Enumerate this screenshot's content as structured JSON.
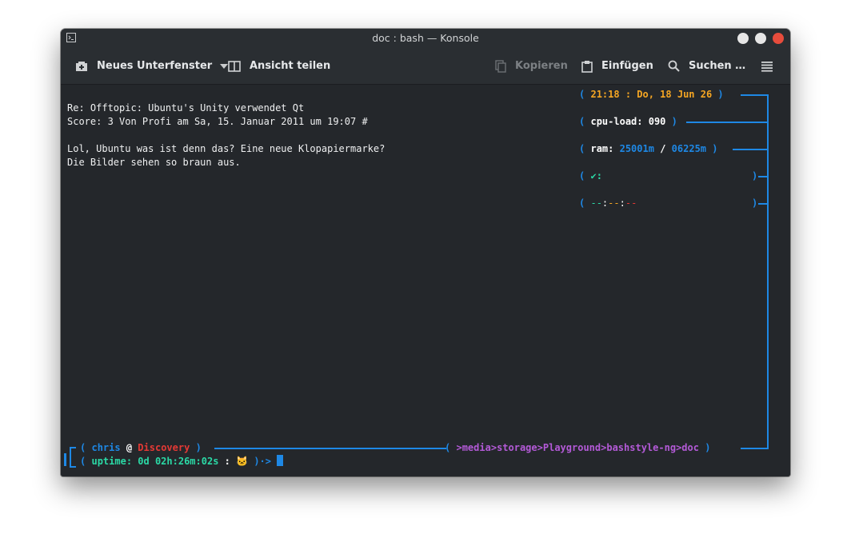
{
  "window": {
    "title": "doc : bash — Konsole",
    "icon": "terminal-icon"
  },
  "toolbar": {
    "new_tab": "Neues Unterfenster",
    "split_view": "Ansicht teilen",
    "copy": "Kopieren",
    "paste": "Einfügen",
    "find": "Suchen …"
  },
  "terminal": {
    "lines": [
      "Re: Offtopic: Ubuntu's Unity verwendet Qt",
      "Score: 3 Von Profi am Sa, 15. Januar 2011 um 19:07 #",
      "Lol, Ubuntu was ist denn das? Eine neue Klopapiermarke?",
      "Die Bilder sehen so braun aus."
    ]
  },
  "status": {
    "open_paren": "(",
    "close_paren": ")",
    "clock": "21:18 : Do, 18 Jun 26",
    "cpu_label": "cpu-load:",
    "cpu_value": "090",
    "ram_label": "ram:",
    "ram_used": "25001m",
    "ram_sep": "/",
    "ram_total": "06225m",
    "check": "✔:",
    "dash_green": "--",
    "colon1": ":",
    "dash_orange": "--",
    "colon2": ":",
    "dash_red": "--"
  },
  "prompt": {
    "user": "chris",
    "at": "@",
    "host": "Discovery",
    "path_gt": ">",
    "path_media": "media",
    "path_storage": "storage",
    "path_playground": "Playground",
    "path_bashstyle": "bashstyle-ng",
    "path_doc": "doc",
    "uptime_label": "uptime:",
    "uptime_value": "0d 02h:26m:02s",
    "uptime_sep": ":",
    "cat": "🐱",
    "arrow": ")·>"
  },
  "colors": {
    "accent": "#1e88e5",
    "orange": "#f5a623",
    "green": "#2bd9a6",
    "red": "#e53935",
    "purple": "#b45ad8",
    "close_button": "#e74c3c"
  }
}
